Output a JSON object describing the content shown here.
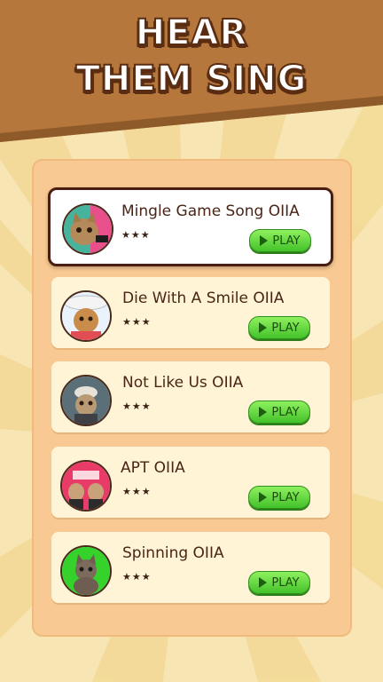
{
  "header": {
    "line1": "HEAR",
    "line2": "THEM SING"
  },
  "songs": [
    {
      "title": "Mingle Game Song OIIA",
      "stars": "★★★",
      "play_label": "PLAY",
      "thumb_bg": "#46b49c"
    },
    {
      "title": "Die With A Smile OIIA",
      "stars": "★★★",
      "play_label": "PLAY",
      "thumb_bg": "#eaf3fb"
    },
    {
      "title": "Not Like Us OIIA",
      "stars": "★★★",
      "play_label": "PLAY",
      "thumb_bg": "#5b6f78"
    },
    {
      "title": "APT OIIA",
      "stars": "★★★",
      "play_label": "PLAY",
      "thumb_bg": "#e83b67"
    },
    {
      "title": "Spinning OIIA",
      "stars": "★★★",
      "play_label": "PLAY",
      "thumb_bg": "#35d22b"
    }
  ],
  "colors": {
    "header_brown": "#b5773c",
    "panel": "#f8c992",
    "card": "#fff5d6",
    "play_green": "#43c22a",
    "title_text": "#4a2416"
  }
}
